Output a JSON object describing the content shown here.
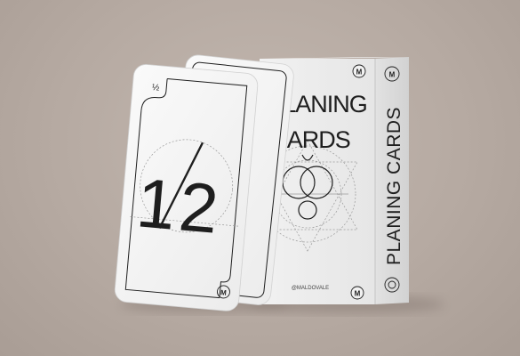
{
  "product": {
    "deck_title_line1": "PLANING",
    "deck_title_line2": "CARDS",
    "side_title": "PLANING CARDS",
    "handle": "@MALDOVALE",
    "logo_letter": "M"
  },
  "front_card": {
    "value_main": "1/2",
    "value_numerator": "1",
    "value_denominator": "2",
    "corner_value": "½",
    "corner_logo": "M"
  },
  "colors": {
    "background": "#b8aca4",
    "card": "#f4f4f4",
    "ink": "#1e1e1e",
    "guide_lines": "#9a9a9a"
  }
}
